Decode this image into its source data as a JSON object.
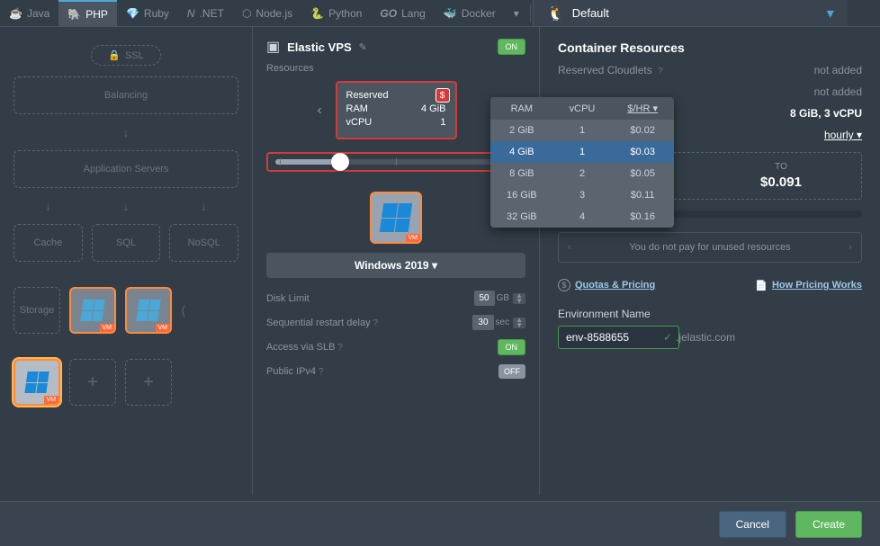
{
  "tabs": [
    "Java",
    "PHP",
    "Ruby",
    ".NET",
    "Node.js",
    "Python",
    "Lang",
    "Docker"
  ],
  "active_tab_index": 1,
  "env_selector": {
    "label": "Default"
  },
  "left": {
    "ssl": "SSL",
    "balancing": "Balancing",
    "app_servers": "Application Servers",
    "cache": "Cache",
    "sql": "SQL",
    "nosql": "NoSQL",
    "storage": "Storage",
    "vm_badge": "VM"
  },
  "center": {
    "title": "Elastic VPS",
    "toggle": "ON",
    "resources_label": "Resources",
    "reserved": {
      "title": "Reserved",
      "ram_label": "RAM",
      "ram_val": "4 GiB",
      "vcpu_label": "vCPU",
      "vcpu_val": "1"
    },
    "os": "Windows 2019",
    "disk_limit": {
      "label": "Disk Limit",
      "val": "50",
      "unit": "GB"
    },
    "restart_delay": {
      "label": "Sequential restart delay",
      "val": "30",
      "unit": "sec"
    },
    "access_slb": {
      "label": "Access via SLB",
      "val": "ON"
    },
    "public_ipv4": {
      "label": "Public IPv4",
      "val": "OFF"
    }
  },
  "pricing_table": {
    "headers": [
      "RAM",
      "vCPU",
      "$/HR"
    ],
    "rows": [
      {
        "ram": "2 GiB",
        "vcpu": "1",
        "price": "$0.02"
      },
      {
        "ram": "4 GiB",
        "vcpu": "1",
        "price": "$0.03"
      },
      {
        "ram": "8 GiB",
        "vcpu": "2",
        "price": "$0.05"
      },
      {
        "ram": "16 GiB",
        "vcpu": "3",
        "price": "$0.11"
      },
      {
        "ram": "32 GiB",
        "vcpu": "4",
        "price": "$0.16"
      }
    ],
    "selected_index": 1
  },
  "right": {
    "title": "Container Resources",
    "reserved_cloudlets_label": "Reserved Cloudlets",
    "not_added": "not added",
    "scaling_summary": "8 GiB, 3 vCPU",
    "hourly": "hourly",
    "price_to_label": "TO",
    "price_to_val": "$0.091",
    "info_banner": "You do not pay for unused resources",
    "quotas": "Quotas & Pricing",
    "how_pricing": "How Pricing Works",
    "env_name_label": "Environment Name",
    "env_name_val": "env-8588655",
    "env_domain": ".jelastic.com"
  },
  "footer": {
    "cancel": "Cancel",
    "create": "Create"
  }
}
